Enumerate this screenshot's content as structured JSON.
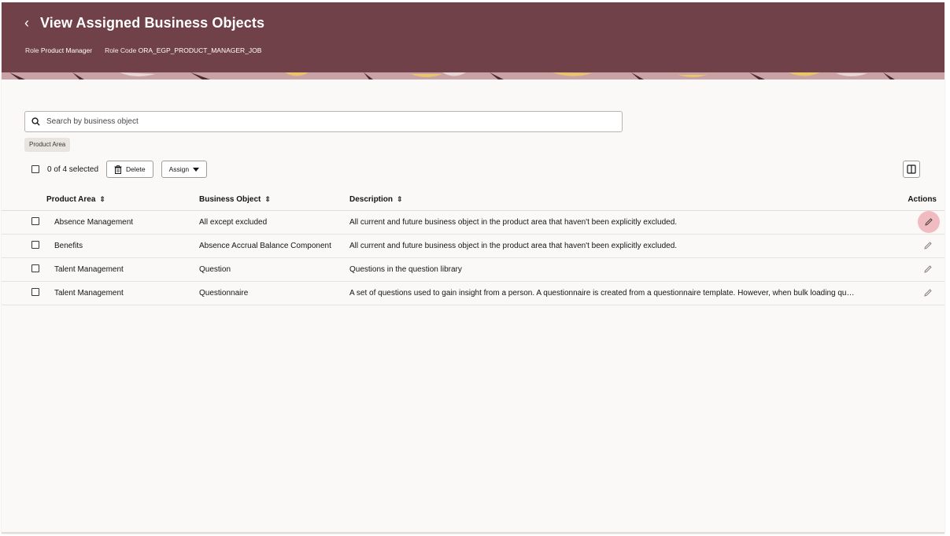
{
  "header": {
    "title": "View Assigned Business Objects",
    "role_label": "Role",
    "role_value": "Product Manager",
    "role_code_label": "Role Code",
    "role_code_value": "ORA_EGP_PRODUCT_MANAGER_JOB"
  },
  "search": {
    "placeholder": "Search by business object",
    "value": ""
  },
  "filter_chip": "Product Area",
  "toolbar": {
    "selected_text": "0 of 4 selected",
    "delete_label": "Delete",
    "assign_label": "Assign"
  },
  "table": {
    "columns": [
      "Product Area",
      "Business Object",
      "Description",
      "Actions"
    ],
    "rows": [
      {
        "area": "Absence Management",
        "object": "All except excluded",
        "description": "All current and future business object in the product area that haven't been explicitly excluded."
      },
      {
        "area": "Benefits",
        "object": "Absence Accrual Balance Component",
        "description": "All current and future business object in the product area that haven't been explicitly excluded."
      },
      {
        "area": "Talent Management",
        "object": "Question",
        "description": "Questions in the question library"
      },
      {
        "area": "Talent Management",
        "object": "Questionnaire",
        "description": "A set of questions used to gain insight from a person. A questionnaire is created from a questionnaire template. However, when bulk loading qu…"
      }
    ]
  },
  "icons": {
    "back": "chevron-left-icon",
    "search": "search-icon",
    "delete": "trash-icon",
    "assign_caret": "caret-down-icon",
    "columns": "columns-icon",
    "sort": "sort-icon",
    "edit": "pencil-icon"
  },
  "colors": {
    "header_bg": "#714149",
    "page_bg": "#fbf9f8",
    "edit_hover": "#f1bcc1"
  }
}
